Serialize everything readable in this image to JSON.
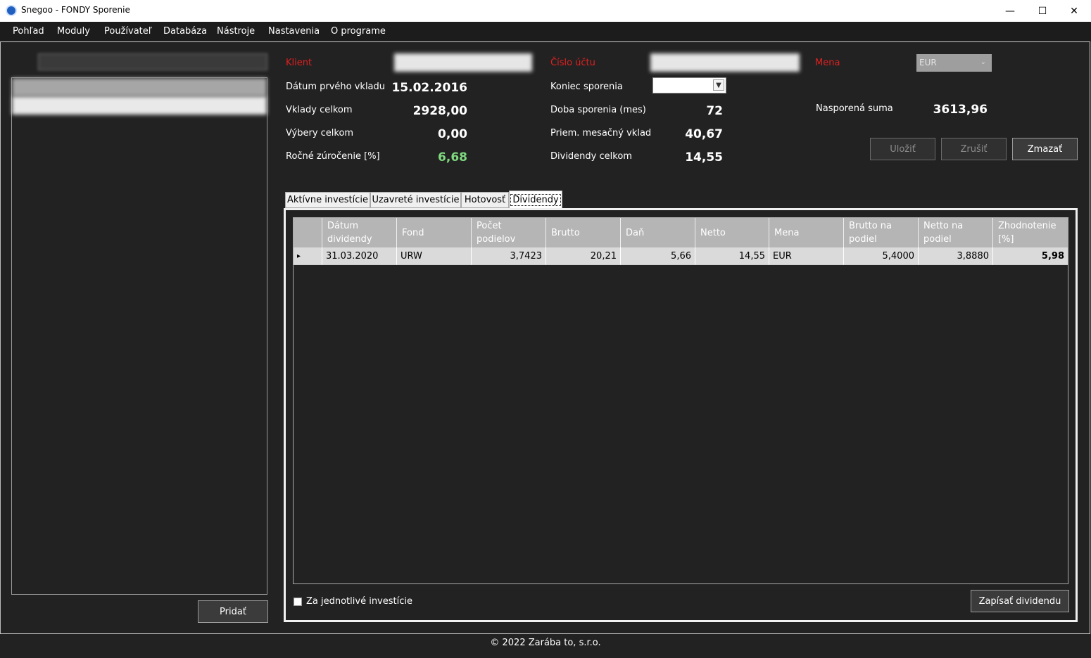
{
  "window": {
    "title": "Snegoo - FONDY Sporenie",
    "minimize": "—",
    "maximize": "☐",
    "close": "✕"
  },
  "menu": [
    "Pohľad",
    "Moduly",
    "Používateľ",
    "Databáza",
    "Nástroje",
    "Nastavenia",
    "O programe"
  ],
  "left": {
    "add_button": "Pridať"
  },
  "form": {
    "klient_label": "Klient",
    "cislo_uctu_label": "Číslo účtu",
    "mena_label": "Mena",
    "mena_value": "EUR",
    "datum_prveho_vkladu_label": "Dátum prvého vkladu",
    "datum_prveho_vkladu_value": "15.02.2016",
    "vklady_celkom_label": "Vklady celkom",
    "vklady_celkom_value": "2928,00",
    "vybery_celkom_label": "Výbery celkom",
    "vybery_celkom_value": "0,00",
    "rocne_zurocenie_label": "Ročné zúročenie [%]",
    "rocne_zurocenie_value": "6,68",
    "koniec_sporenia_label": "Koniec sporenia",
    "doba_sporenia_label": "Doba sporenia (mes)",
    "doba_sporenia_value": "72",
    "priem_vklad_label": "Priem. mesačný vklad",
    "priem_vklad_value": "40,67",
    "dividendy_celkom_label": "Dividendy celkom",
    "dividendy_celkom_value": "14,55",
    "nasporena_suma_label": "Nasporená suma",
    "nasporena_suma_value": "3613,96"
  },
  "actions": {
    "save": "Uložiť",
    "cancel": "Zrušiť",
    "delete": "Zmazať"
  },
  "tabs": [
    "Aktívne investície",
    "Uzavreté investície",
    "Hotovosť",
    "Dividendy"
  ],
  "grid": {
    "headers": [
      [
        "Dátum",
        "dividendy"
      ],
      [
        "Fond",
        ""
      ],
      [
        "Počet",
        "podielov"
      ],
      [
        "Brutto",
        ""
      ],
      [
        "Daň",
        ""
      ],
      [
        "Netto",
        ""
      ],
      [
        "Mena",
        ""
      ],
      [
        "Brutto na",
        "podiel"
      ],
      [
        "Netto na",
        "podiel"
      ],
      [
        "Zhodnotenie",
        "[%]"
      ]
    ],
    "rows": [
      [
        "31.03.2020",
        "URW",
        "3,7423",
        "20,21",
        "5,66",
        "14,55",
        "EUR",
        "5,4000",
        "3,8880",
        "5,98"
      ]
    ],
    "row_indicator": "▸"
  },
  "bottom": {
    "checkbox_label": "Za jednotlivé investície",
    "record_button": "Zapísať dividendu"
  },
  "footer": "© 2022 Zarába to, s.r.o."
}
